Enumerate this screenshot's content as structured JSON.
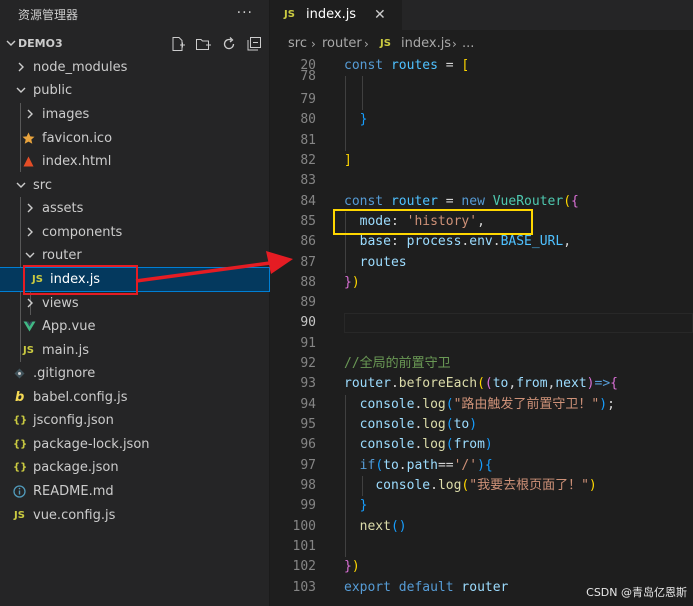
{
  "sidebar": {
    "title": "资源管理器",
    "more": "···",
    "project": "DEMO3",
    "tree": [
      {
        "label": "node_modules",
        "type": "folder",
        "expanded": false
      },
      {
        "label": "public",
        "type": "folder",
        "expanded": true
      },
      {
        "label": "images",
        "type": "folder",
        "expanded": false
      },
      {
        "label": "favicon.ico",
        "type": "ico"
      },
      {
        "label": "index.html",
        "type": "html"
      },
      {
        "label": "src",
        "type": "folder",
        "expanded": true
      },
      {
        "label": "assets",
        "type": "folder",
        "expanded": false
      },
      {
        "label": "components",
        "type": "folder",
        "expanded": false
      },
      {
        "label": "router",
        "type": "folder",
        "expanded": true
      },
      {
        "label": "index.js",
        "type": "js",
        "icon_text": "JS"
      },
      {
        "label": "views",
        "type": "folder",
        "expanded": false
      },
      {
        "label": "App.vue",
        "type": "vue"
      },
      {
        "label": "main.js",
        "type": "js",
        "icon_text": "JS"
      },
      {
        "label": ".gitignore",
        "type": "git"
      },
      {
        "label": "babel.config.js",
        "type": "babel"
      },
      {
        "label": "jsconfig.json",
        "type": "json",
        "icon_text": "{}"
      },
      {
        "label": "package-lock.json",
        "type": "json",
        "icon_text": "{}"
      },
      {
        "label": "package.json",
        "type": "json",
        "icon_text": "{}"
      },
      {
        "label": "README.md",
        "type": "info"
      },
      {
        "label": "vue.config.js",
        "type": "js",
        "icon_text": "JS"
      }
    ]
  },
  "editor": {
    "tab": {
      "icon_text": "JS",
      "name": "index.js",
      "close": "✕"
    },
    "breadcrumb": {
      "part1": "src",
      "part2": "router",
      "icon_text": "JS",
      "part3": "index.js",
      "part4": "..."
    },
    "line_numbers": [
      "20",
      "78",
      "79",
      "80",
      "81",
      "82",
      "83",
      "84",
      "85",
      "86",
      "87",
      "88",
      "89",
      "90",
      "91",
      "92",
      "93",
      "94",
      "95",
      "96",
      "97",
      "98",
      "99",
      "100",
      "101",
      "102",
      "103"
    ],
    "active_line": "90"
  },
  "colors": {
    "highlight_box": "#ffd700",
    "arrow": "#e51c23",
    "selection": "#04395e"
  },
  "watermark": "CSDN @青岛亿恩斯"
}
